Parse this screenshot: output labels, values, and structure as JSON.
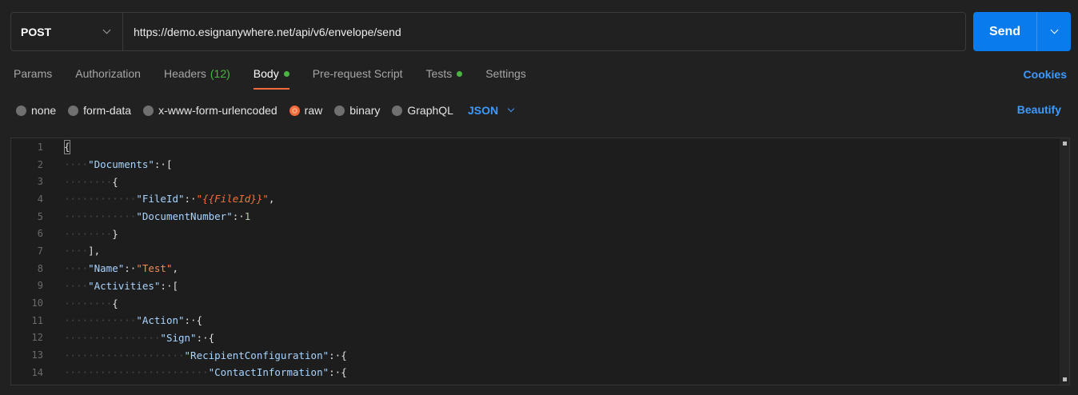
{
  "request": {
    "method": "POST",
    "url": "https://demo.esignanywhere.net/api/v6/envelope/send",
    "send_label": "Send"
  },
  "tabs": [
    {
      "label": "Params"
    },
    {
      "label": "Authorization"
    },
    {
      "label": "Headers",
      "count": "(12)"
    },
    {
      "label": "Body"
    },
    {
      "label": "Pre-request Script"
    },
    {
      "label": "Tests"
    },
    {
      "label": "Settings"
    }
  ],
  "cookies_label": "Cookies",
  "body_types": [
    {
      "label": "none"
    },
    {
      "label": "form-data"
    },
    {
      "label": "x-www-form-urlencoded"
    },
    {
      "label": "raw",
      "selected": true
    },
    {
      "label": "binary"
    },
    {
      "label": "GraphQL"
    }
  ],
  "language": "JSON",
  "beautify_label": "Beautify",
  "colors": {
    "accent": "#097bed",
    "active_tab": "#f26b3a",
    "indicator": "#4bb543",
    "link": "#3d9aff"
  },
  "code_lines": [
    {
      "n": "1",
      "indent": "",
      "tokens": [
        {
          "t": "pun",
          "v": "{"
        }
      ]
    },
    {
      "n": "2",
      "indent": "····",
      "tokens": [
        {
          "t": "key",
          "v": "\"Documents\""
        },
        {
          "t": "pun",
          "v": ":·["
        }
      ]
    },
    {
      "n": "3",
      "indent": "········",
      "tokens": [
        {
          "t": "pun",
          "v": "{"
        }
      ]
    },
    {
      "n": "4",
      "indent": "············",
      "tokens": [
        {
          "t": "key",
          "v": "\"FileId\""
        },
        {
          "t": "pun",
          "v": ":·"
        },
        {
          "t": "var",
          "v": "\"{{FileId}}\""
        },
        {
          "t": "pun",
          "v": ","
        }
      ]
    },
    {
      "n": "5",
      "indent": "············",
      "tokens": [
        {
          "t": "key",
          "v": "\"DocumentNumber\""
        },
        {
          "t": "pun",
          "v": ":·"
        },
        {
          "t": "num",
          "v": "1"
        }
      ]
    },
    {
      "n": "6",
      "indent": "········",
      "tokens": [
        {
          "t": "pun",
          "v": "}"
        }
      ]
    },
    {
      "n": "7",
      "indent": "····",
      "tokens": [
        {
          "t": "pun",
          "v": "],"
        }
      ]
    },
    {
      "n": "8",
      "indent": "····",
      "tokens": [
        {
          "t": "key",
          "v": "\"Name\""
        },
        {
          "t": "pun",
          "v": ":·"
        },
        {
          "t": "str",
          "v": "\"Test\""
        },
        {
          "t": "pun",
          "v": ","
        }
      ]
    },
    {
      "n": "9",
      "indent": "····",
      "tokens": [
        {
          "t": "key",
          "v": "\"Activities\""
        },
        {
          "t": "pun",
          "v": ":·["
        }
      ]
    },
    {
      "n": "10",
      "indent": "········",
      "tokens": [
        {
          "t": "pun",
          "v": "{"
        }
      ]
    },
    {
      "n": "11",
      "indent": "············",
      "tokens": [
        {
          "t": "key",
          "v": "\"Action\""
        },
        {
          "t": "pun",
          "v": ":·{"
        }
      ]
    },
    {
      "n": "12",
      "indent": "················",
      "tokens": [
        {
          "t": "key",
          "v": "\"Sign\""
        },
        {
          "t": "pun",
          "v": ":·{"
        }
      ]
    },
    {
      "n": "13",
      "indent": "····················",
      "tokens": [
        {
          "t": "key",
          "v": "\"RecipientConfiguration\""
        },
        {
          "t": "pun",
          "v": ":·{"
        }
      ]
    },
    {
      "n": "14",
      "indent": "························",
      "tokens": [
        {
          "t": "key",
          "v": "\"ContactInformation\""
        },
        {
          "t": "pun",
          "v": ":·{"
        }
      ]
    }
  ]
}
